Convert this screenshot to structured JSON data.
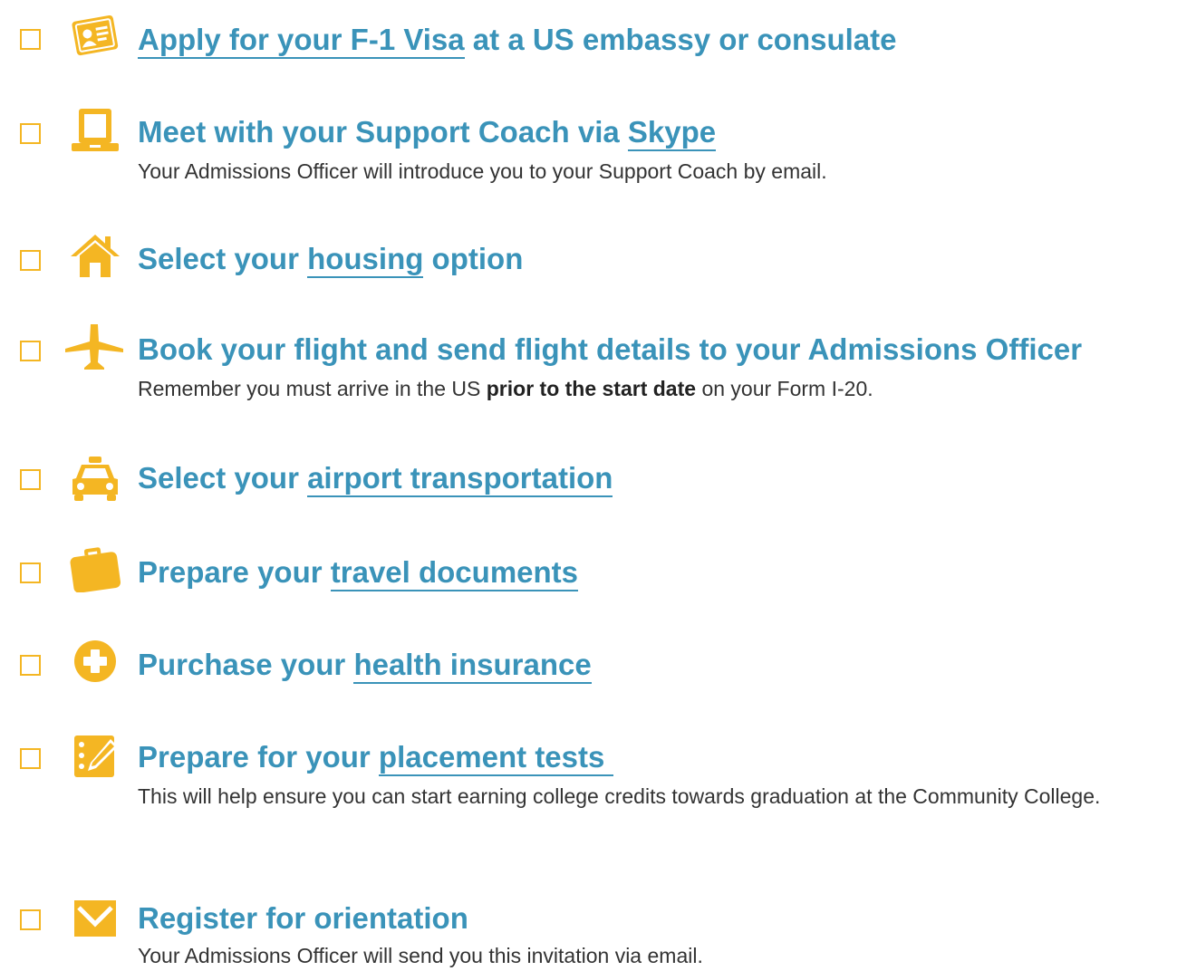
{
  "accent_color": "#f4b623",
  "title_color": "#3a93b9",
  "items": [
    {
      "icon": "id-card-icon",
      "link": "Apply for your F-1 Visa",
      "after": " at a US embassy or consulate"
    },
    {
      "icon": "laptop-icon",
      "before": "Meet with your Support Coach via ",
      "link": "Skype",
      "desc": "Your Admissions Officer will introduce you to your Support Coach by email."
    },
    {
      "icon": "house-icon",
      "before": "Select your ",
      "link": "housing",
      "after": " option"
    },
    {
      "icon": "airplane-icon",
      "text": "Book your flight and send flight details to your Admissions Officer",
      "desc_before": "Remember you must arrive in the US ",
      "desc_bold": "prior to the start date",
      "desc_after": " on your Form I-20."
    },
    {
      "icon": "taxi-icon",
      "before": "Select your ",
      "link": "airport transportation"
    },
    {
      "icon": "briefcase-icon",
      "before": "Prepare your ",
      "link": "travel documents"
    },
    {
      "icon": "medical-plus-icon",
      "before": "Purchase your ",
      "link": "health insurance"
    },
    {
      "icon": "notepad-pencil-icon",
      "before": "Prepare for your ",
      "link": "placement tests ",
      "desc": "This will help ensure you can start earning college credits towards graduation at the Community College."
    },
    {
      "icon": "envelope-icon",
      "text": "Register for orientation",
      "desc": "Your Admissions Officer will send you this invitation via email."
    }
  ]
}
